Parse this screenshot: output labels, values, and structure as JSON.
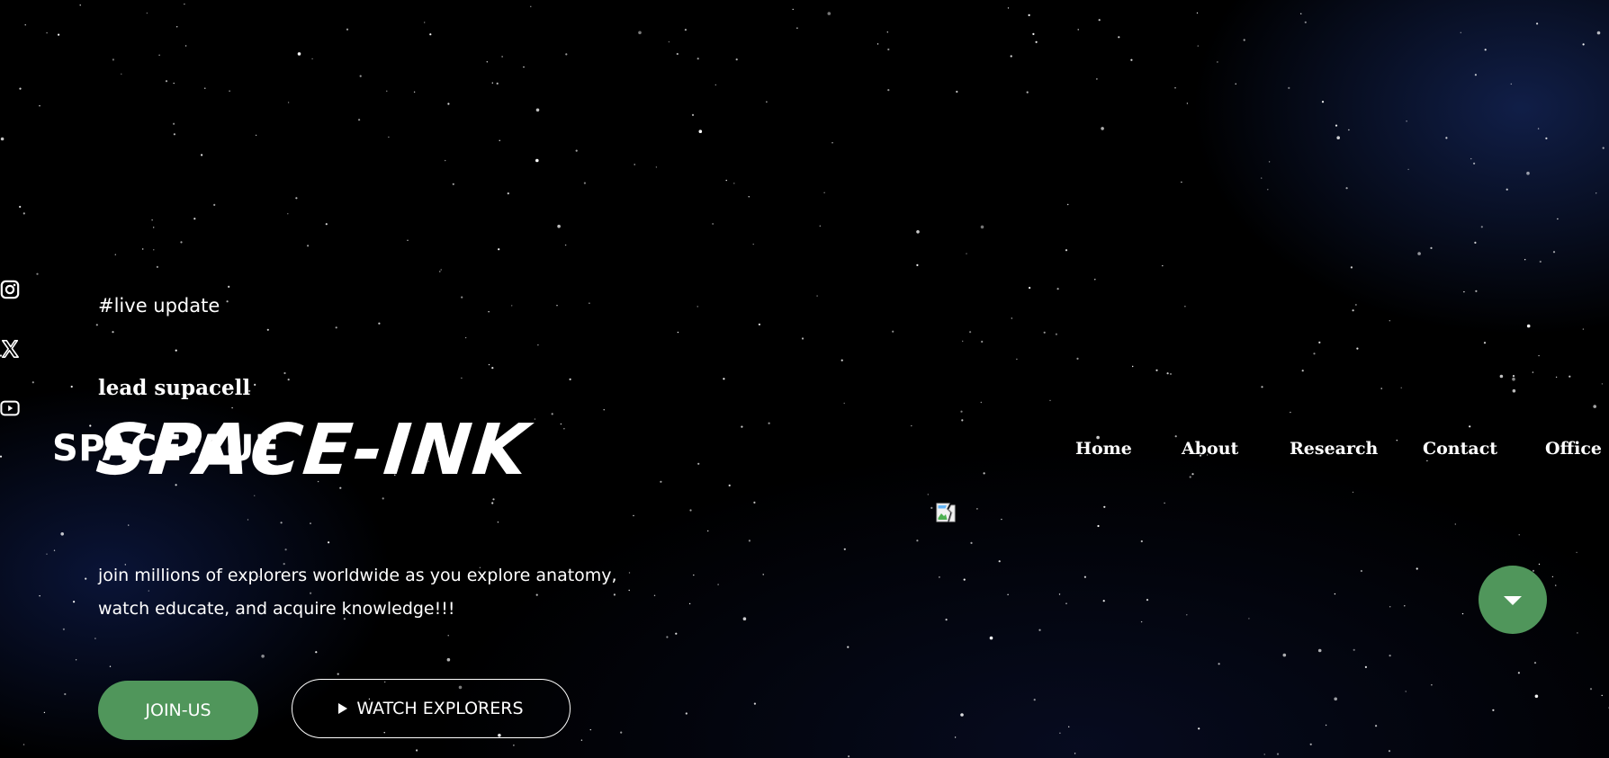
{
  "brand": {
    "logo_text": "SPACE-AUE"
  },
  "social": {
    "icons": [
      "instagram-icon",
      "x-icon",
      "youtube-icon"
    ]
  },
  "hero": {
    "tag": "#live update",
    "lead": "lead supacell",
    "title": "SPACE-INK",
    "description": "join millions of explorers worldwide as you explore anatomy, watch educate, and acquire knowledge!!!",
    "join_label": "JOIN-US",
    "watch_label": "WATCH EXPLORERS"
  },
  "nav": {
    "items": [
      "Home",
      "About",
      "Research",
      "Contact",
      "Office"
    ]
  },
  "colors": {
    "accent": "#50965b",
    "background": "#000000",
    "text": "#ffffff"
  }
}
